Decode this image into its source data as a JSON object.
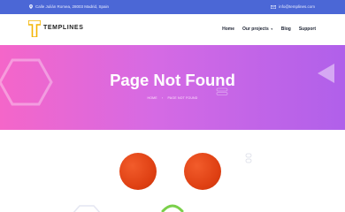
{
  "topbar": {
    "address": "Calle Julián Romea, 28003 Madrid, Spain",
    "email": "info@templines.com",
    "address_icon": "location-pin-icon",
    "email_icon": "envelope-icon"
  },
  "logo": {
    "text": "TEMPLINES",
    "accent": "#f4b400"
  },
  "nav": {
    "items": [
      {
        "label": "Home"
      },
      {
        "label": "Our projects",
        "dropdown": true
      },
      {
        "label": "Blog"
      },
      {
        "label": "Support"
      }
    ]
  },
  "hero": {
    "title": "Page Not Found",
    "breadcrumb": [
      "HOME",
      "PAGE NOT FOUND"
    ],
    "gradient": [
      "#f466c9",
      "#b060ea"
    ]
  },
  "colors": {
    "topbar": "#4b67d6",
    "eye": "#de3f12",
    "mouth": "#7ad04a"
  }
}
